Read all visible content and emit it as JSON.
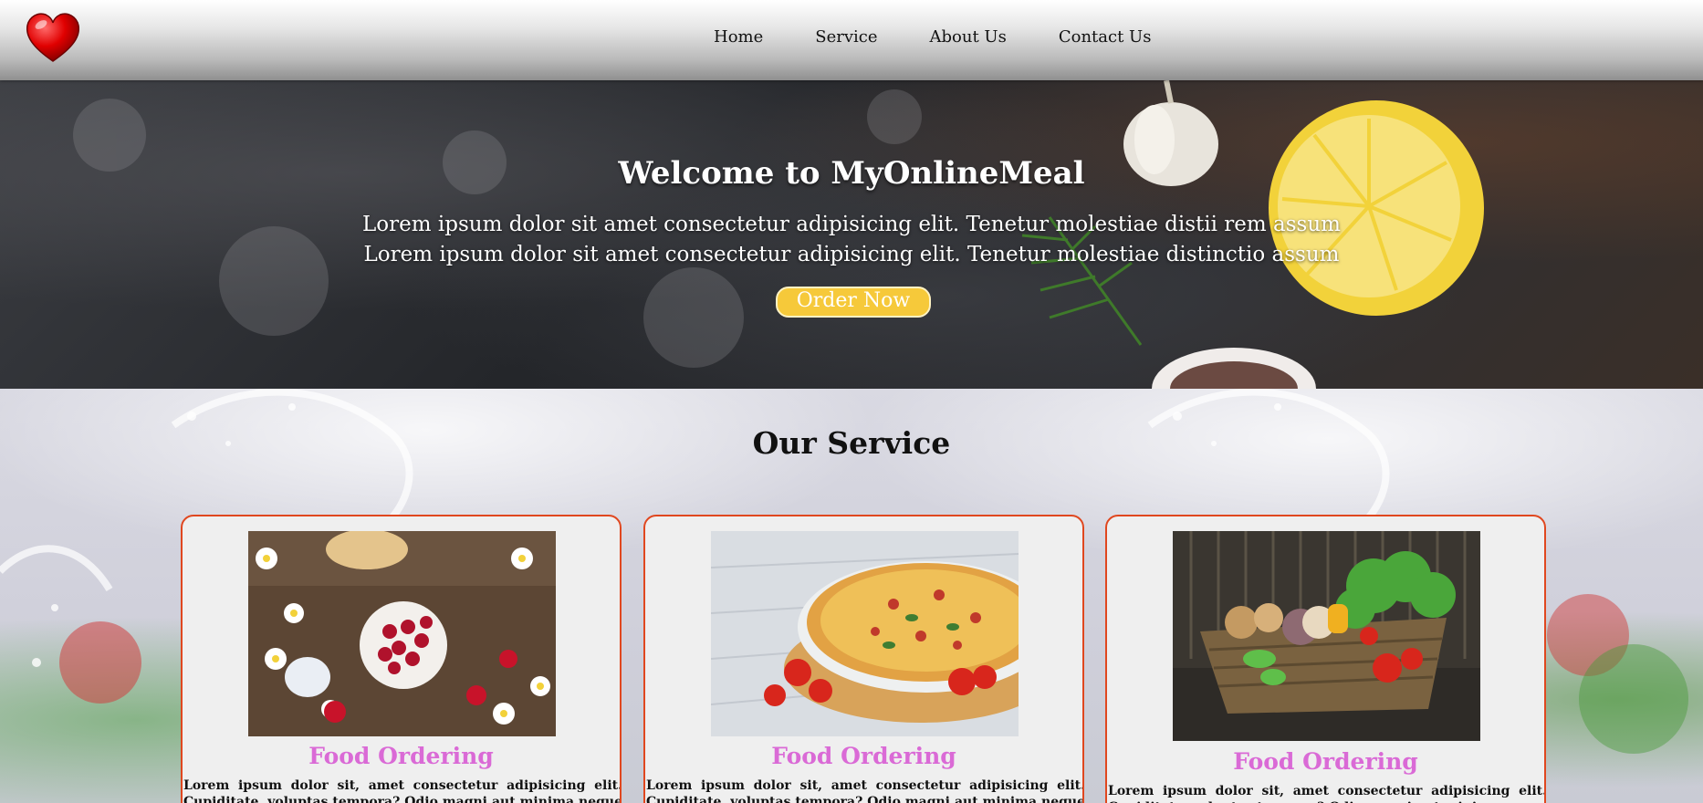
{
  "header": {
    "logo_icon": "heart-icon",
    "nav": [
      {
        "label": "Home"
      },
      {
        "label": "Service"
      },
      {
        "label": "About Us"
      },
      {
        "label": "Contact Us"
      }
    ]
  },
  "hero": {
    "title": "Welcome to MyOnlineMeal",
    "line1": "Lorem ipsum dolor sit amet consectetur adipisicing elit. Tenetur molestiae distii rem assum",
    "line2": "Lorem ipsum dolor sit amet consectetur adipisicing elit. Tenetur molestiae distinctio assum",
    "button_label": "Order Now",
    "button_color": "#f6c93a"
  },
  "services": {
    "title": "Our Service",
    "cards": [
      {
        "title": "Food Ordering",
        "text": "Lorem ipsum dolor sit, amet consectetur adipisicing elit. Cupiditate, voluptas tempora? Odio magni aut minima neque dolorum tempora distinctio",
        "image": "berries-and-breakfast-photo"
      },
      {
        "title": "Food Ordering",
        "text": "Lorem ipsum dolor sit, amet consectetur adipisicing elit. Cupiditate, voluptas tempora? Odio magni aut minima neque dolorum tempora distinctio",
        "image": "pizza-photo"
      },
      {
        "title": "Food Ordering",
        "text": "Lorem ipsum dolor sit, amet consectetur adipisicing elit. Cupiditate, voluptas tempora? Odio magni aut minima neque dolorum tempora distinctio",
        "image": "vegetable-basket-photo"
      }
    ],
    "accent_border": "#e0471f",
    "title_color": "#da6ad6"
  }
}
